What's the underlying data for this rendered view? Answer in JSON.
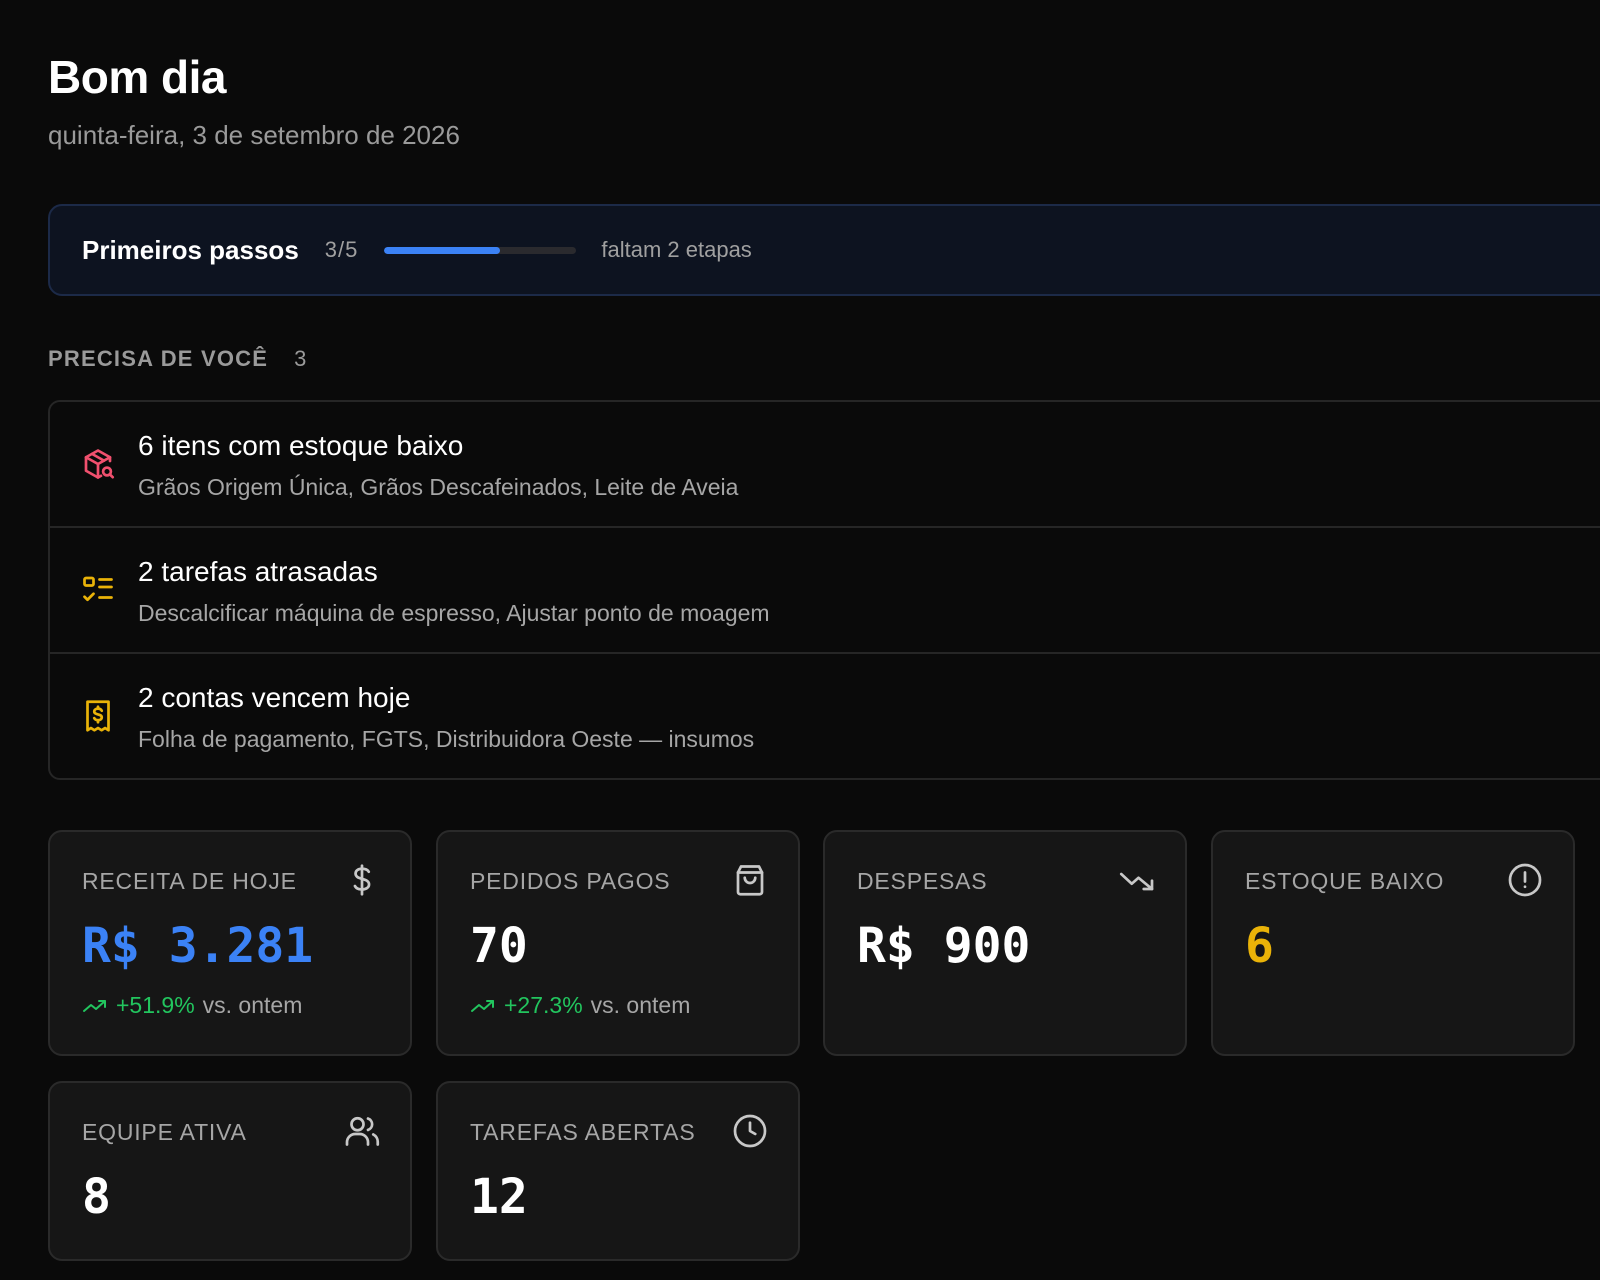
{
  "header": {
    "greeting": "Bom dia",
    "date": "quinta-feira, 3 de setembro de 2026"
  },
  "onboarding": {
    "title": "Primeiros passos",
    "count": "3/5",
    "progress": 0.6,
    "remaining": "faltam 2 etapas",
    "accent_color": "#3b82f6"
  },
  "attention": {
    "title": "PRECISA DE VOCÊ",
    "count": "3",
    "items": [
      {
        "icon": "package-search-icon",
        "icon_color": "#f0506e",
        "title": "6 itens com estoque baixo",
        "subtitle": "Grãos Origem Única, Grãos Descafeinados, Leite de Aveia"
      },
      {
        "icon": "task-list-icon",
        "icon_color": "#eab308",
        "title": "2 tarefas atrasadas",
        "subtitle": "Descalcificar máquina de espresso, Ajustar ponto de moagem"
      },
      {
        "icon": "receipt-icon",
        "icon_color": "#eab308",
        "title": "2 contas vencem hoje",
        "subtitle": "Folha de pagamento, FGTS, Distribuidora Oeste — insumos"
      }
    ]
  },
  "stats": [
    {
      "label": "RECEITA DE HOJE",
      "icon": "dollar-icon",
      "value": "R$ 3.281",
      "value_color": "#3b82f6",
      "trend_delta": "+51.9%",
      "trend_ref": "vs. ontem"
    },
    {
      "label": "PEDIDOS PAGOS",
      "icon": "shopping-bag-icon",
      "value": "70",
      "trend_delta": "+27.3%",
      "trend_ref": "vs. ontem"
    },
    {
      "label": "DESPESAS",
      "icon": "trending-down-icon",
      "value": "R$ 900"
    },
    {
      "label": "ESTOQUE BAIXO",
      "icon": "alert-circle-icon",
      "value": "6",
      "value_color": "#eab308"
    },
    {
      "label": "EQUIPE ATIVA",
      "icon": "users-icon",
      "value": "8"
    },
    {
      "label": "TAREFAS ABERTAS",
      "icon": "clock-icon",
      "value": "12"
    }
  ],
  "colors": {
    "positive": "#22c55e",
    "background": "#0a0a0a",
    "card_background": "#161616"
  }
}
